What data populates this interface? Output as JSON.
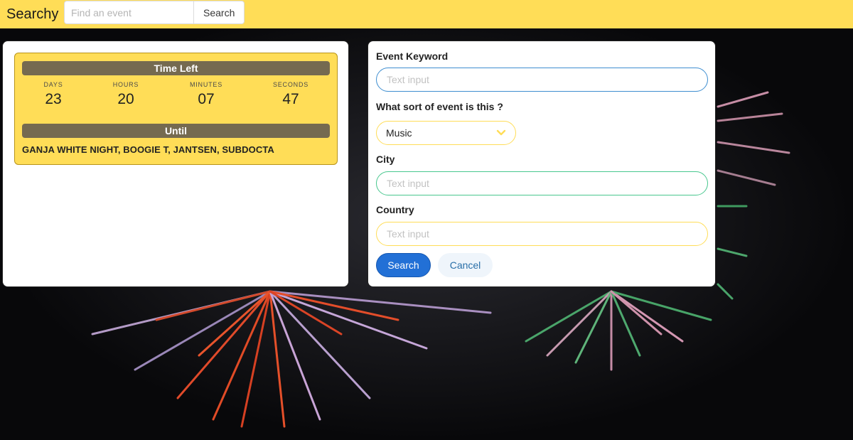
{
  "navbar": {
    "brand": "Searchy",
    "search_placeholder": "Find an event",
    "search_button": "Search"
  },
  "countdown": {
    "title": "Time Left",
    "units": [
      {
        "label": "DAYS",
        "value": "23"
      },
      {
        "label": "HOURS",
        "value": "20"
      },
      {
        "label": "MINUTES",
        "value": "07"
      },
      {
        "label": "SECONDS",
        "value": "47"
      }
    ],
    "until_label": "Until",
    "event_name": "GANJA WHITE NIGHT, BOOGIE T, JANTSEN, SUBDOCTA"
  },
  "form": {
    "keyword_label": "Event Keyword",
    "keyword_placeholder": "Text input",
    "type_label": "What sort of event is this ?",
    "type_selected": "Music",
    "city_label": "City",
    "city_placeholder": "Text input",
    "country_label": "Country",
    "country_placeholder": "Text input",
    "search_button": "Search",
    "cancel_button": "Cancel"
  },
  "colors": {
    "navbar": "#ffdd57",
    "timer_bar": "#756a50",
    "primary_button": "#2270d6",
    "keyword_border": "#3e8ed0",
    "city_border": "#48c78e",
    "country_border": "#ffdd57"
  }
}
